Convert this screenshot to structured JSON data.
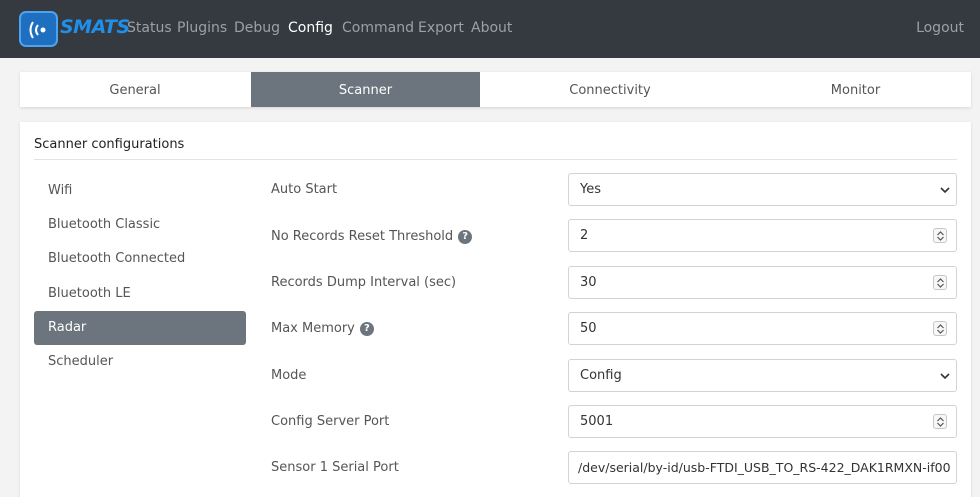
{
  "navbar": {
    "brand": "SMATS",
    "links": [
      "Status",
      "Plugins",
      "Debug",
      "Config",
      "Command",
      "Export",
      "About"
    ],
    "active_link": "Config",
    "logout": "Logout"
  },
  "tabs": [
    "General",
    "Scanner",
    "Connectivity",
    "Monitor"
  ],
  "active_tab": "Scanner",
  "card_title": "Scanner configurations",
  "side_nav": [
    "Wifi",
    "Bluetooth Classic",
    "Bluetooth Connected",
    "Bluetooth LE",
    "Radar",
    "Scheduler"
  ],
  "active_side_item": "Radar",
  "form": {
    "auto_start": {
      "label": "Auto Start",
      "value": "Yes"
    },
    "no_records_reset_threshold": {
      "label": "No Records Reset Threshold",
      "value": "2"
    },
    "records_dump_interval": {
      "label": "Records Dump Interval (sec)",
      "value": "30"
    },
    "max_memory": {
      "label": "Max Memory",
      "value": "50"
    },
    "mode": {
      "label": "Mode",
      "value": "Config"
    },
    "config_server_port": {
      "label": "Config Server Port",
      "value": "5001"
    },
    "sensor1_serial_port": {
      "label": "Sensor 1 Serial Port",
      "value": "/dev/serial/by-id/usb-FTDI_USB_TO_RS-422_DAK1RMXN-if00"
    }
  },
  "help_glyph": "?",
  "colors": {
    "navbar": "#343a40",
    "active_gray": "#6c757d",
    "brand_blue": "#1f8fea"
  }
}
